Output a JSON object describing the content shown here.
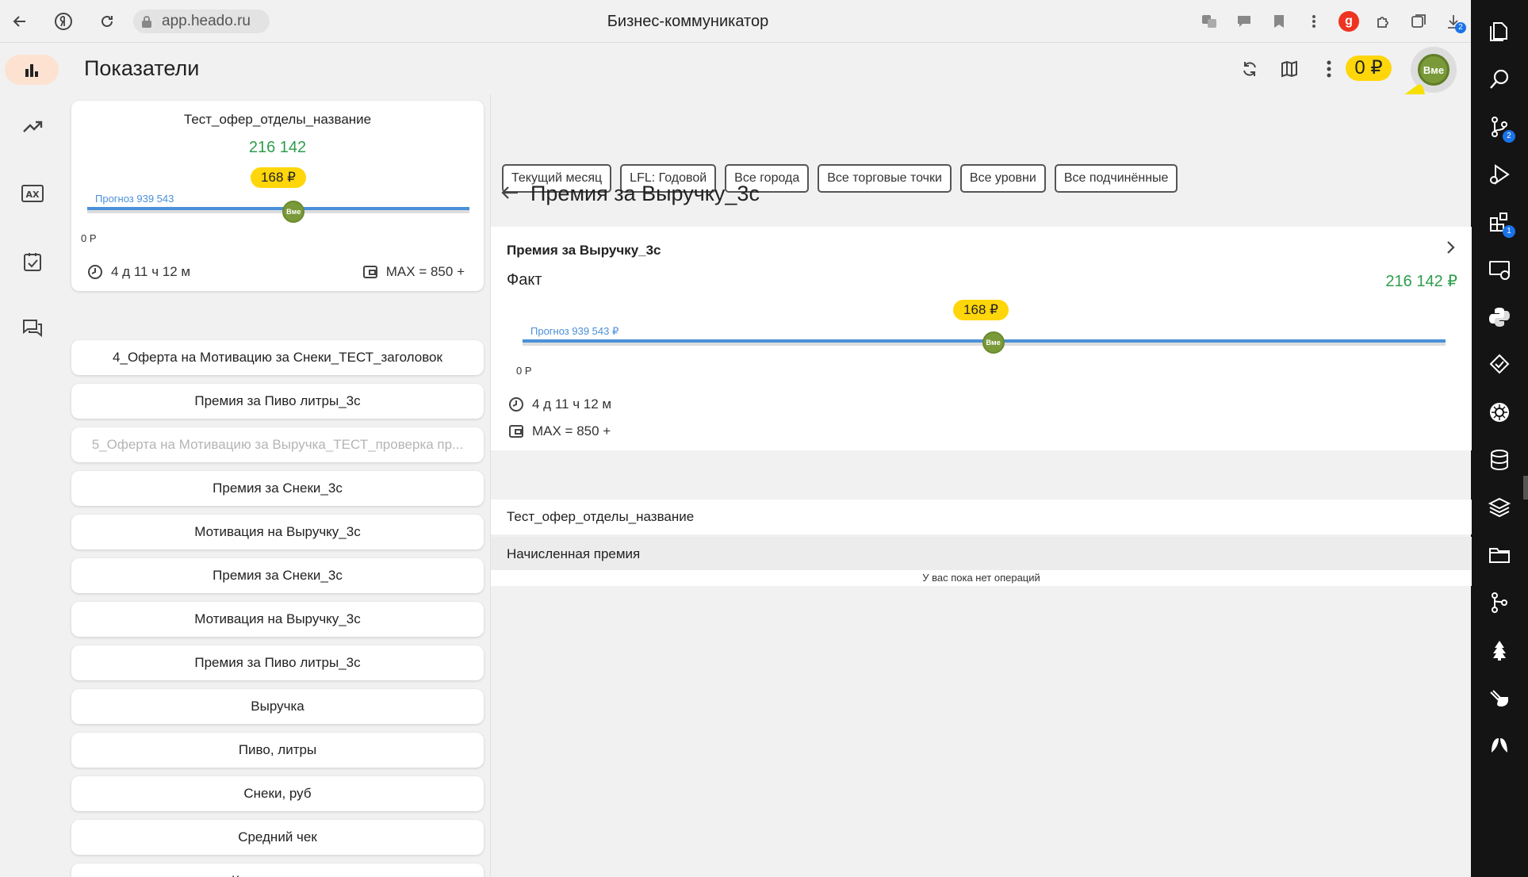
{
  "browser": {
    "url": "app.heado.ru",
    "page_title": "Бизнес-коммуникатор",
    "download_badge": "2"
  },
  "app": {
    "title": "Показатели",
    "balance": "0 ₽",
    "avatar": "Вме"
  },
  "main_card": {
    "title": "Тест_офер_отделы_название",
    "value": "216 142",
    "bonus": "168 ₽",
    "forecast": "Прогноз 939 543",
    "zero": "0 Р",
    "marker": "Вме",
    "progress": 0.54,
    "time_left": "4 д 11 ч 12 м",
    "max": "MAX = 850 +"
  },
  "list_items": [
    {
      "label": "4_Оферта на Мотивацию за Снеки_ТЕСТ_заголовок",
      "faded": false
    },
    {
      "label": "Премия за Пиво литры_3с",
      "faded": false
    },
    {
      "label": "5_Оферта на Мотивацию за Выручка_ТЕСТ_проверка пр...",
      "faded": true
    },
    {
      "label": "Премия за Снеки_3с",
      "faded": false
    },
    {
      "label": "Мотивация на Выручку_3с",
      "faded": false
    },
    {
      "label": "Премия за Снеки_3с",
      "faded": false
    },
    {
      "label": "Мотивация на Выручку_3с",
      "faded": false
    },
    {
      "label": "Премия за Пиво литры_3с",
      "faded": false
    },
    {
      "label": "Выручка",
      "faded": false
    },
    {
      "label": "Пиво, литры",
      "faded": false
    },
    {
      "label": "Снеки, руб",
      "faded": false
    },
    {
      "label": "Средний чек",
      "faded": false
    },
    {
      "label": "Кол-во продаж",
      "faded": false
    }
  ],
  "filters": [
    "Текущий месяц",
    "LFL: Годовой",
    "Все города",
    "Все торговые точки",
    "Все уровни",
    "Все подчинённые"
  ],
  "detail": {
    "title": "Премия за Выручку_3с",
    "card_title": "Премия за Выручку_3с",
    "fact_label": "Факт",
    "fact_value": "216 142 ₽",
    "bonus": "168 ₽",
    "forecast": "Прогноз 939 543 ₽",
    "zero": "0 Р",
    "marker": "Вме",
    "progress": 0.51,
    "time_left": "4 д 11 ч 12 м",
    "max": "MAX = 850 +",
    "offer_row": "Тест_офер_отделы_название",
    "accrued_row": "Начисленная премия",
    "empty_note": "У вас пока нет операций"
  },
  "colors": {
    "accent_green": "#2e9e4d",
    "accent_yellow": "#ffd60a",
    "progress_blue": "#4a90d9",
    "avatar_green": "#7a9a3a"
  }
}
